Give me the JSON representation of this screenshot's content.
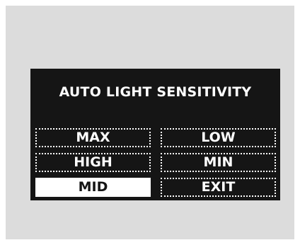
{
  "screen": {
    "title": "AUTO LIGHT SENSITIVITY",
    "options": {
      "max": "MAX",
      "high": "HIGH",
      "mid": "MID",
      "low": "LOW",
      "min": "MIN",
      "exit": "EXIT"
    },
    "selected": "MID"
  },
  "colors": {
    "screen_bg": "#151515",
    "text": "#ffffff",
    "frame_bg": "#dcdcdc"
  }
}
